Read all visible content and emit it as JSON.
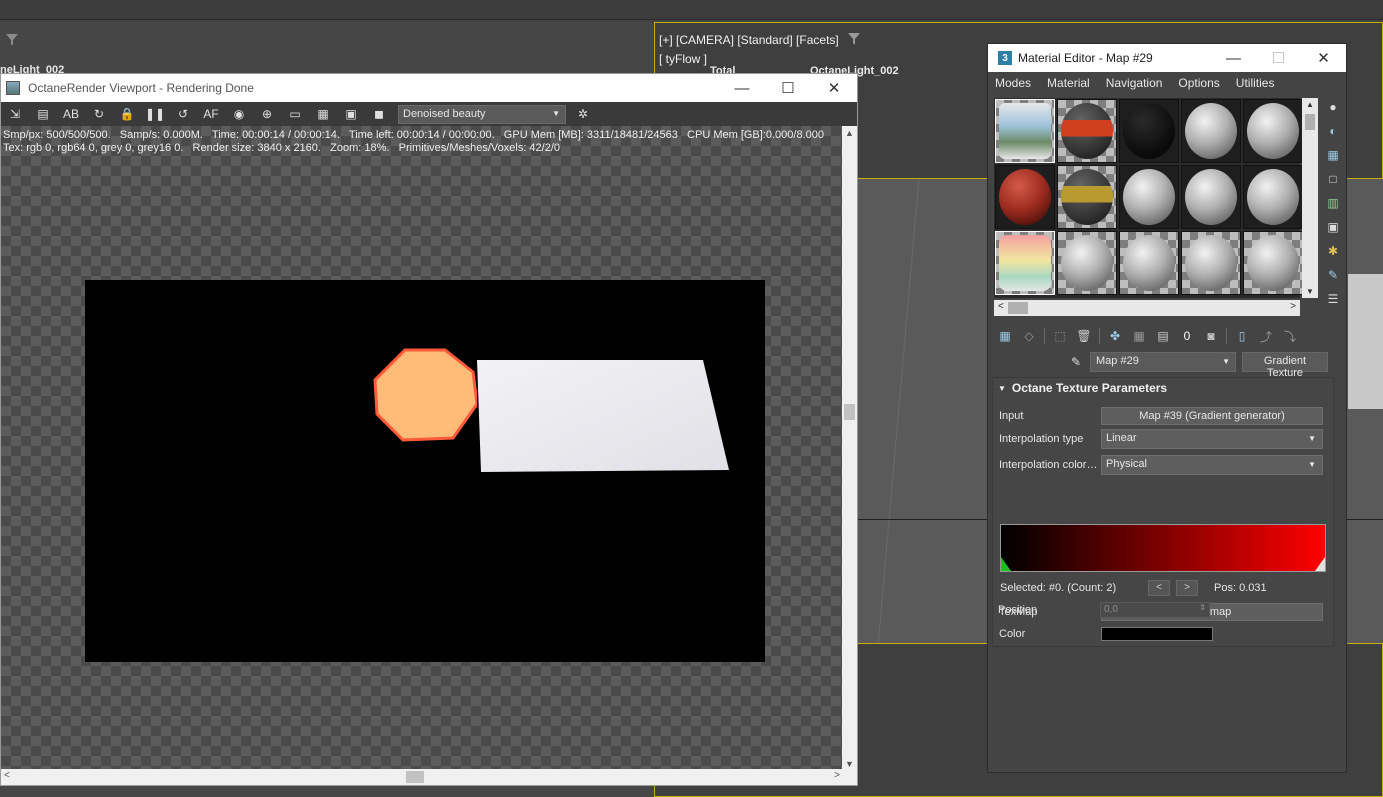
{
  "background": {
    "left_viewport_label": "neLight_002",
    "right_viewport": {
      "header": "[+] [CAMERA] [Standard] [Facets]",
      "subheader": "[ tyFlow ]",
      "stat_label": "Total",
      "stat_value": "OctaneLight_002"
    }
  },
  "octane": {
    "title": "OctaneRender Viewport - Rendering Done",
    "stats_line1": "Smp/px: 500/500/500.   Samp/s: 0.000M.   Time: 00:00:14 / 00:00:14.   Time left: 00:00:14 / 00:00:00.   GPU Mem [MB]: 3311/18481/24563   CPU Mem [GB]:0.000/8.000",
    "stats_line2": "Tex: rgb 0, rgb64 0, grey 0, grey16 0.   Render size: 3840 x 2160.   Zoom: 18%.   Primitives/Meshes/Voxels: 42/2/0",
    "render_pass": "Denoised beauty",
    "toolbar_icons": [
      "export-icon",
      "copy-icon",
      "ab-compare-icon",
      "refresh-icon",
      "lock-icon",
      "pause-icon",
      "restart-icon",
      "af-icon",
      "color-wheel-icon",
      "region-icon",
      "display-icon",
      "film-icon",
      "settings-icon",
      "camera-icon",
      "gear-icon"
    ],
    "toolbar_glyphs": [
      "⇲",
      "▤",
      "AB",
      "↻",
      "🔒",
      "❚❚",
      "↺",
      "AF",
      "◉",
      "⊕",
      "▭",
      "▦",
      "▣",
      "◼",
      "✲"
    ]
  },
  "material_editor": {
    "title": "Material Editor - Map #29",
    "menu": [
      "Modes",
      "Material",
      "Navigation",
      "Options",
      "Utilities"
    ],
    "map_name": "Map #29",
    "map_type": "Gradient Texture",
    "rollout_title": "Octane Texture Parameters",
    "params": {
      "input_label": "Input",
      "input_value": "Map #39 (Gradient generator)",
      "interp_type_label": "Interpolation type",
      "interp_type_value": "Linear",
      "interp_color_label": "Interpolation color…",
      "interp_color_value": "Physical",
      "selected_text": "Selected: #0. (Count: 2)",
      "prev": "<",
      "next": ">",
      "pos_text": "Pos: 0.031",
      "texmap_label": "TexMap",
      "texmap_value": "No map",
      "color_label": "Color",
      "color_value": "#000000",
      "position_label": "Position",
      "position_value": "0,0"
    },
    "gradient": {
      "start_color": "#000000",
      "end_color": "#ff0000"
    }
  }
}
